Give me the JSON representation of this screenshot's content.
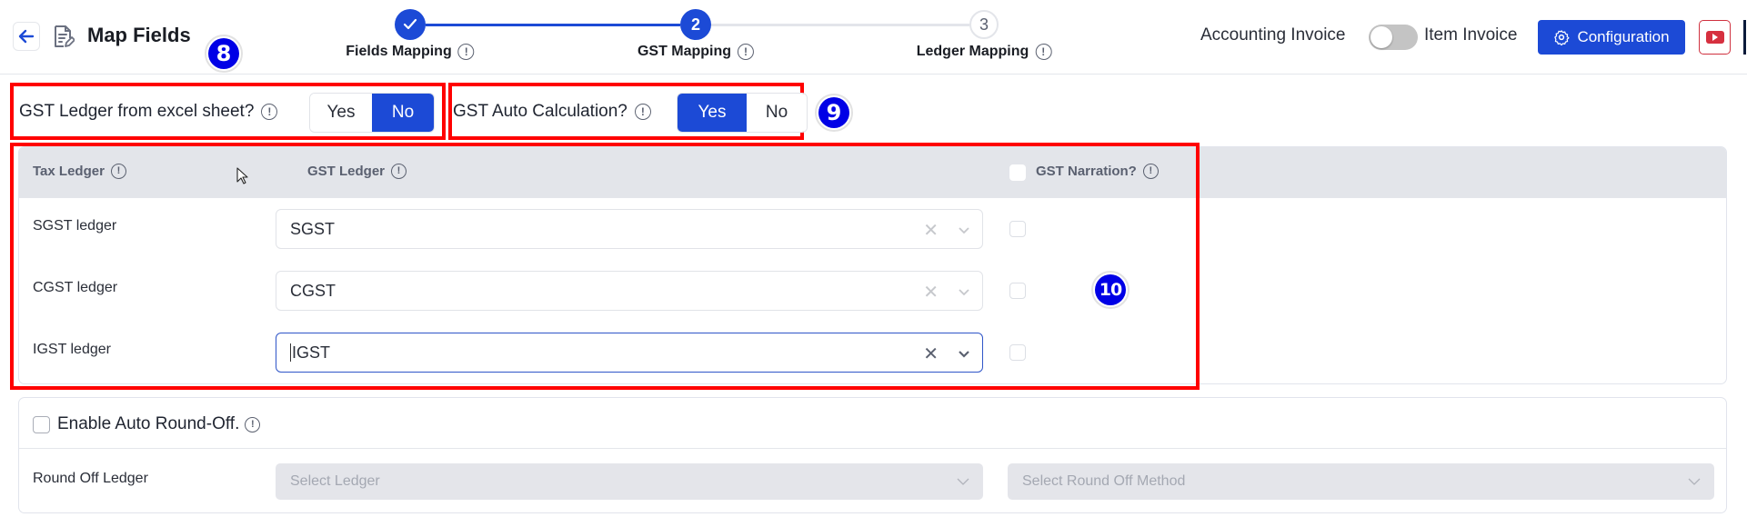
{
  "header": {
    "title": "Map Fields",
    "steps": [
      {
        "number": "1",
        "label": "Fields Mapping",
        "state": "completed"
      },
      {
        "number": "2",
        "label": "GST Mapping",
        "state": "active"
      },
      {
        "number": "3",
        "label": "Ledger Mapping",
        "state": "pending"
      }
    ],
    "invoice_toggle": {
      "left_label": "Accounting Invoice",
      "right_label": "Item Invoice",
      "on": false
    },
    "configuration_label": "Configuration"
  },
  "annotations": {
    "badge_8": "8",
    "badge_9": "9",
    "badge_10": "10"
  },
  "options": {
    "gst_ledger_from_excel": {
      "label": "GST Ledger from excel sheet?",
      "yes": "Yes",
      "no": "No",
      "selected": "No"
    },
    "gst_auto_calculation": {
      "label": "GST Auto Calculation?",
      "yes": "Yes",
      "no": "No",
      "selected": "Yes"
    }
  },
  "gst_table": {
    "columns": {
      "tax_ledger": "Tax Ledger",
      "gst_ledger": "GST Ledger",
      "gst_narration": "GST Narration?"
    },
    "narration_all_checked": false,
    "rows": [
      {
        "label": "SGST ledger",
        "value": "SGST",
        "narration": false,
        "focused": false
      },
      {
        "label": "CGST ledger",
        "value": "CGST",
        "narration": false,
        "focused": false
      },
      {
        "label": "IGST ledger",
        "value": "IGST",
        "narration": false,
        "focused": true
      }
    ]
  },
  "round_off": {
    "enable_label": "Enable Auto Round-Off.",
    "enabled": false,
    "ledger_label": "Round Off Ledger",
    "ledger_placeholder": "Select Ledger",
    "method_placeholder": "Select Round Off Method"
  },
  "colors": {
    "accent": "#1c4ad6",
    "annotation_red": "#ff0000",
    "annotation_badge": "#0000e6",
    "youtube_red": "#d6303f"
  }
}
